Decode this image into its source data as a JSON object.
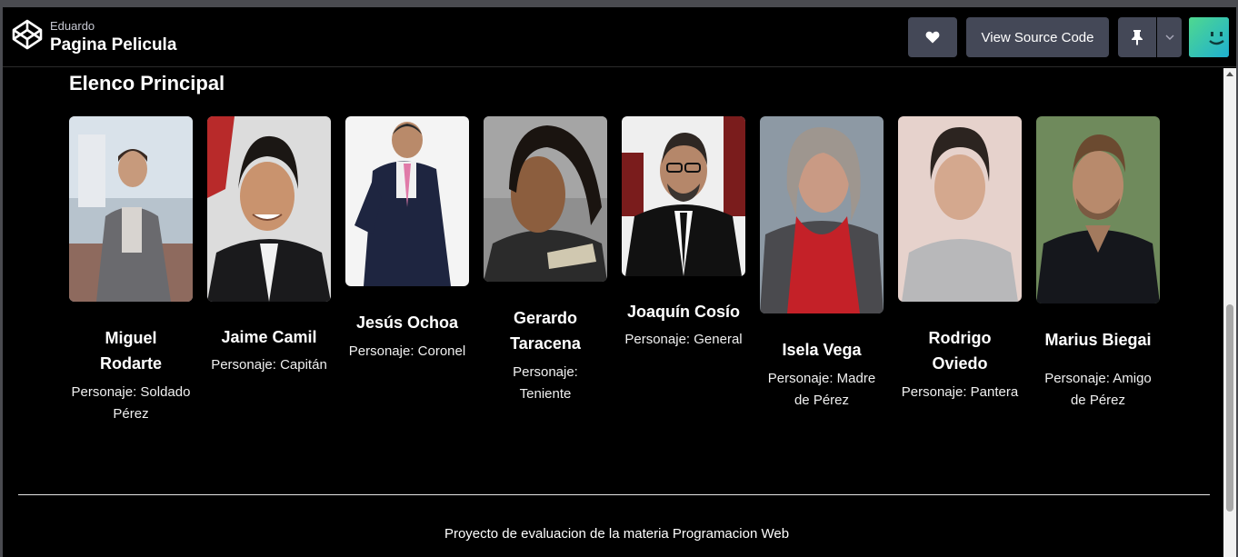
{
  "header": {
    "owner": "Eduardo",
    "title": "Pagina Pelicula",
    "view_source_label": "View Source Code"
  },
  "icons": {
    "logo": "codepen-logo-icon",
    "like": "heart-icon",
    "pin": "pin-icon",
    "menu": "chevron-down-icon",
    "user": "avatar-smiley-icon"
  },
  "main": {
    "section_title": "Elenco Principal",
    "cast": [
      {
        "name": "Miguel Rodarte",
        "role": "Personaje: Soldado Pérez"
      },
      {
        "name": "Jaime Camil",
        "role": "Personaje: Capitán"
      },
      {
        "name": "Jesús Ochoa",
        "role": "Personaje: Coronel"
      },
      {
        "name": "Gerardo Taracena",
        "role": "Personaje: Teniente"
      },
      {
        "name": "Joaquín Cosío",
        "role": "Personaje: General"
      },
      {
        "name": "Isela Vega",
        "role": "Personaje: Madre de Pérez"
      },
      {
        "name": "Rodrigo Oviedo",
        "role": "Personaje: Pantera"
      },
      {
        "name": "Marius Biegai",
        "role": "Personaje: Amigo de Pérez"
      }
    ]
  },
  "footer": {
    "text": "Proyecto de evaluacion de la materia Programacion Web"
  },
  "colors": {
    "button_bg": "#444857",
    "page_bg": "#000000",
    "avatar_start": "#3ad3a6",
    "avatar_end": "#1fb7c9"
  }
}
